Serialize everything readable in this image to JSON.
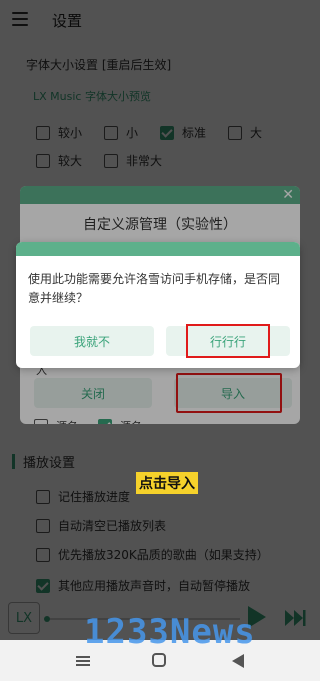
{
  "header": {
    "title": "设置",
    "menu_icon": "hamburger-menu-icon"
  },
  "font_size": {
    "section_label": "字体大小设置 [重启后生效]",
    "preview": "LX Music 字体大小预览",
    "options": [
      {
        "label": "较小",
        "checked": false
      },
      {
        "label": "小",
        "checked": false
      },
      {
        "label": "标准",
        "checked": true
      },
      {
        "label": "大",
        "checked": false
      },
      {
        "label": "较大",
        "checked": false
      },
      {
        "label": "非常大",
        "checked": false
      }
    ]
  },
  "custom_source_dialog": {
    "title": "自定义源管理（实验性）",
    "close_icon": "close-icon",
    "fragment_a": "入",
    "button_close": "关闭",
    "button_import": "导入",
    "fragment_left": "源名",
    "fragment_right": "源名"
  },
  "permission_dialog": {
    "message": "使用此功能需要允许洛雪访问手机存储，是否同意并继续？",
    "cancel_label": "我就不",
    "ok_label": "行行行"
  },
  "playback": {
    "title": "播放设置",
    "options": [
      {
        "label": "记住播放进度",
        "checked": false
      },
      {
        "label": "自动清空已播放列表",
        "checked": false
      },
      {
        "label": "优先播放320K品质的歌曲（如果支持）",
        "checked": false
      },
      {
        "label": "其他应用播放声音时，自动暂停播放",
        "checked": true
      }
    ]
  },
  "player_bar": {
    "logo": "LX",
    "play_icon": "play-icon",
    "next_icon": "next-track-icon"
  },
  "nav": {
    "menu": "recent-apps-icon",
    "home": "home-icon",
    "back": "back-icon"
  },
  "annotation": {
    "caption": "点击导入",
    "watermark": "1233News"
  },
  "colors": {
    "accent": "#3aa37a",
    "dialog_header": "#5db08b",
    "highlight": "#e01a1a",
    "caption_bg": "#f6d22b"
  }
}
